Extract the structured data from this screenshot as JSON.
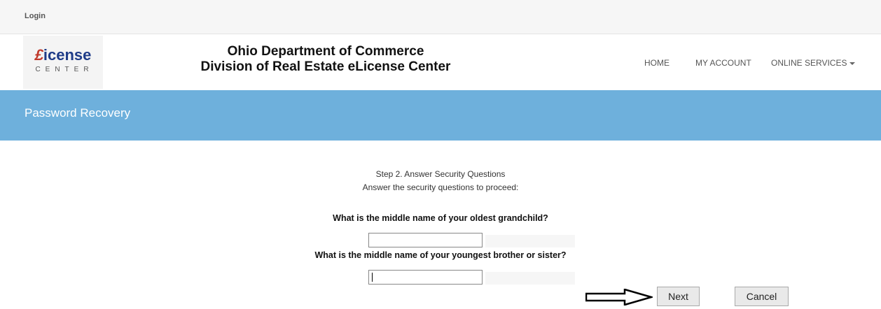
{
  "topbar": {
    "login_label": "Login"
  },
  "logo": {
    "main_prefix": "£",
    "main_text": "icense",
    "sub_text": "CENTER"
  },
  "header": {
    "title_line1": "Ohio Department of Commerce",
    "title_line2": "Division of Real Estate eLicense Center"
  },
  "nav": {
    "home": "HOME",
    "my_account": "MY ACCOUNT",
    "online_services": "ONLINE SERVICES"
  },
  "banner": {
    "title": "Password Recovery"
  },
  "content": {
    "step_title": "Step 2. Answer Security Questions",
    "instructions": "Answer the security questions to proceed:",
    "question1": "What is the middle name of your oldest grandchild?",
    "answer1_value": "",
    "question2": "What is the middle name of your youngest brother or sister?",
    "answer2_value": ""
  },
  "buttons": {
    "next": "Next",
    "cancel": "Cancel"
  },
  "icons": {
    "pointer": "arrow-right-outline-icon",
    "dropdown": "caret-down-icon"
  },
  "colors": {
    "banner": "#6eb0dc",
    "logo_blue": "#1f3c88",
    "logo_red": "#c0392b"
  }
}
